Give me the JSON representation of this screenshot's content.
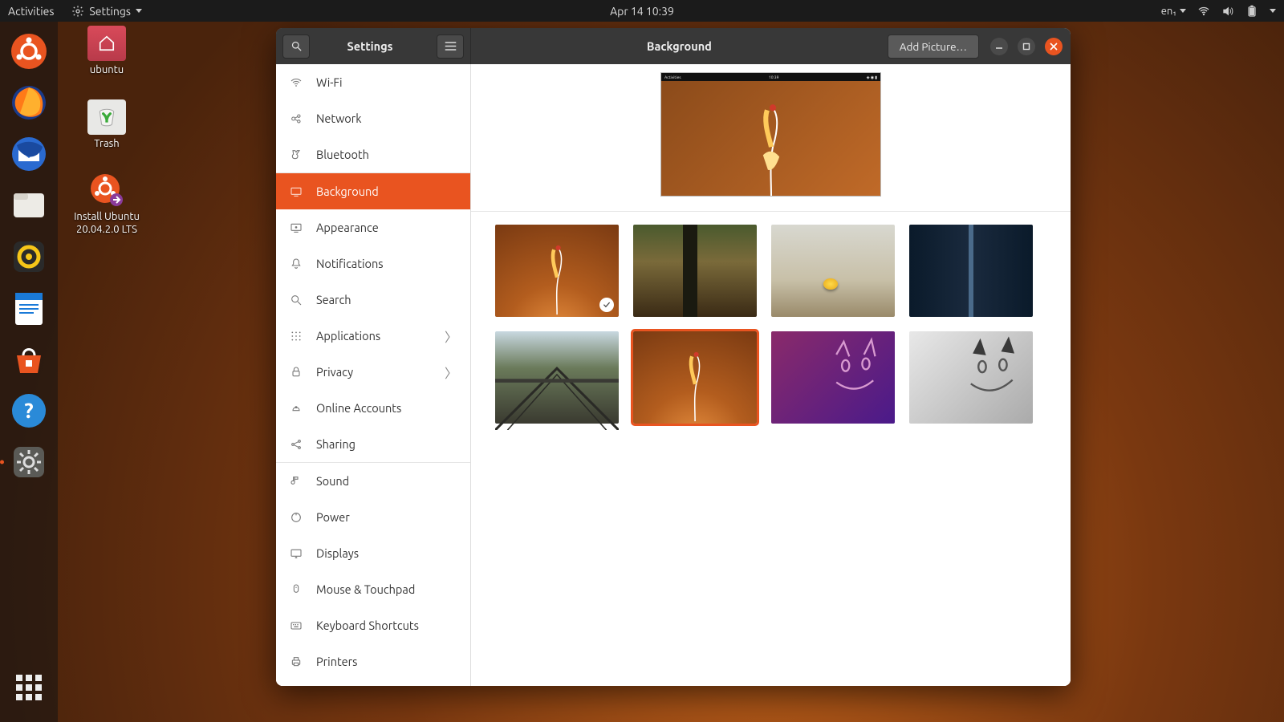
{
  "topbar": {
    "activities": "Activities",
    "app_menu": "Settings",
    "datetime": "Apr 14  10:39",
    "lang": "en₁"
  },
  "desktop": {
    "home": "ubuntu",
    "trash": "Trash",
    "install": "Install Ubuntu 20.04.2.0 LTS"
  },
  "window": {
    "sidebar_title": "Settings",
    "panel_title": "Background",
    "add_picture": "Add Picture…"
  },
  "sidebar": {
    "items": [
      {
        "label": "Wi-Fi"
      },
      {
        "label": "Network"
      },
      {
        "label": "Bluetooth"
      },
      {
        "label": "Background"
      },
      {
        "label": "Appearance"
      },
      {
        "label": "Notifications"
      },
      {
        "label": "Search"
      },
      {
        "label": "Applications",
        "chev": true
      },
      {
        "label": "Privacy",
        "chev": true
      },
      {
        "label": "Online Accounts"
      },
      {
        "label": "Sharing"
      },
      {
        "label": "Sound"
      },
      {
        "label": "Power"
      },
      {
        "label": "Displays"
      },
      {
        "label": "Mouse & Touchpad"
      },
      {
        "label": "Keyboard Shortcuts"
      },
      {
        "label": "Printers"
      }
    ],
    "selected_index": 3,
    "separators_after": [
      2,
      10
    ]
  },
  "preview": {
    "mini_left": "Activities",
    "mini_center": "10:39"
  },
  "wallpapers": {
    "selected_index": 5,
    "checked_index": 0
  },
  "colors": {
    "accent": "#e95420"
  }
}
